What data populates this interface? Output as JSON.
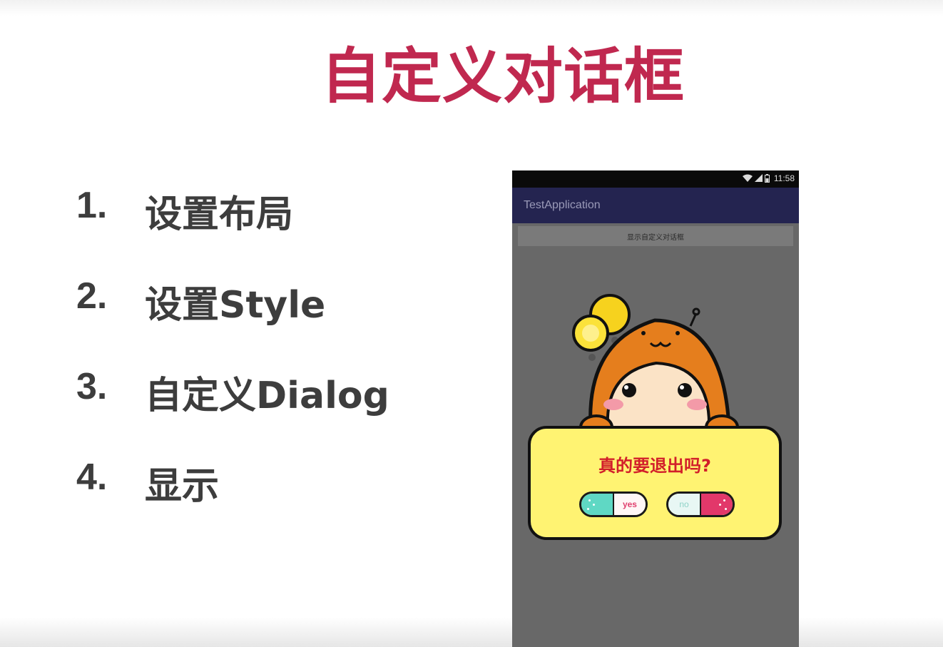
{
  "slide": {
    "title": "自定义对话框",
    "steps": [
      {
        "num": "1.",
        "text": "设置布局"
      },
      {
        "num": "2.",
        "text": "设置Style"
      },
      {
        "num": "3.",
        "text": "自定义Dialog"
      },
      {
        "num": "4.",
        "text": "显示"
      }
    ]
  },
  "phone": {
    "status_time": "11:58",
    "app_title": "TestApplication",
    "button_label": "显示自定义对话框",
    "dialog": {
      "message": "真的要退出吗?",
      "yes_label": "yes",
      "no_label": "no"
    }
  },
  "colors": {
    "title": "#c0284f",
    "app_bar": "#242450",
    "dialog_bg": "#fff372",
    "message": "#d21f2a"
  }
}
